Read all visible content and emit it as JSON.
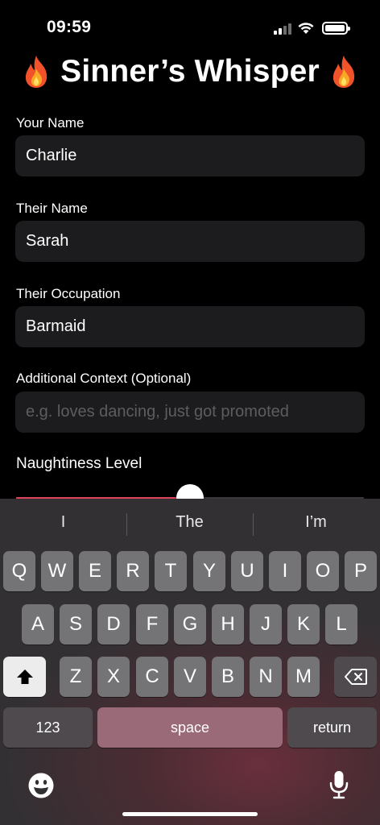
{
  "status_bar": {
    "time": "09:59"
  },
  "title": {
    "text": "Sinner’s Whisper"
  },
  "form": {
    "your_name": {
      "label": "Your Name",
      "value": "Charlie"
    },
    "their_name": {
      "label": "Their Name",
      "value": "Sarah"
    },
    "occupation": {
      "label": "Their Occupation",
      "value": "Barmaid"
    },
    "context": {
      "label": "Additional Context (Optional)",
      "placeholder": "e.g. loves dancing, just got promoted"
    },
    "naughtiness": {
      "label": "Naughtiness Level",
      "fraction": 0.5
    }
  },
  "keyboard": {
    "suggestions": [
      "I",
      "The",
      "I’m"
    ],
    "row1": [
      "Q",
      "W",
      "E",
      "R",
      "T",
      "Y",
      "U",
      "I",
      "O",
      "P"
    ],
    "row2": [
      "A",
      "S",
      "D",
      "F",
      "G",
      "H",
      "J",
      "K",
      "L"
    ],
    "row3": [
      "Z",
      "X",
      "C",
      "V",
      "B",
      "N",
      "M"
    ],
    "numbers_label": "123",
    "space_label": "space",
    "return_label": "return"
  },
  "colors": {
    "accent": "#e0425a",
    "field_bg": "#1c1c1e",
    "keyboard_tint": "#6a2f3c"
  },
  "icons": [
    "fire-icon",
    "shift-icon",
    "backspace-icon",
    "emoji-icon",
    "microphone-icon",
    "wifi-icon",
    "battery-icon",
    "signal-icon"
  ]
}
